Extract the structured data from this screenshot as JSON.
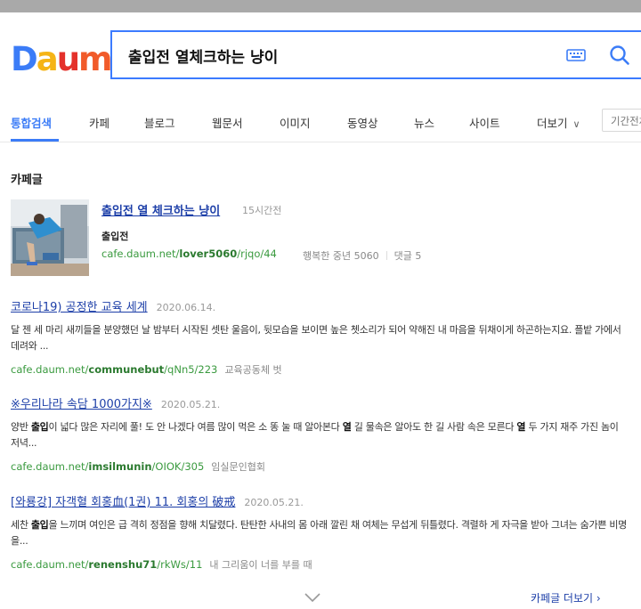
{
  "logo": {
    "letters": [
      "D",
      "a",
      "u",
      "m"
    ],
    "colors": [
      "#3b7cf7",
      "#f5b416",
      "#e4312b",
      "#f15b2a"
    ]
  },
  "search": {
    "query": "출입전 열체크하는 냥이",
    "keyboard_icon": "keyboard-icon",
    "search_icon": "magnifier-icon"
  },
  "tabs": [
    {
      "label": "통합검색",
      "active": true
    },
    {
      "label": "카페"
    },
    {
      "label": "블로그"
    },
    {
      "label": "웹문서"
    },
    {
      "label": "이미지"
    },
    {
      "label": "동영상"
    },
    {
      "label": "뉴스"
    },
    {
      "label": "사이트"
    },
    {
      "label": "더보기"
    }
  ],
  "period_label": "기간전체",
  "section": {
    "title": "카페글"
  },
  "featured": {
    "title": "출입전 열 체크하는 냥이",
    "time": "15시간전",
    "sub": "출입전",
    "url_prefix": "cafe.daum.net/",
    "url_bold": "lover5060",
    "url_suffix": "/rjqo/44",
    "cafe_name": "행복한 중년 5060",
    "comments": "댓글 5"
  },
  "results": [
    {
      "title": "코로나19) 공정한 교육 세계",
      "date": "2020.06.14.",
      "desc_parts": [
        "달 젠 세 마리 새끼들을 분양했던 날 밤부터 시작된 셋탄 울음이, 뒷모습을 보이면 높은 쳇소리가 되어 약해진 내 마음을 뒤채이게 하곤하는지요. 플밭 가에서 데려와 ..."
      ],
      "url_prefix": "cafe.daum.net/",
      "url_bold": "communebut",
      "url_suffix": "/qNn5/223",
      "cafe": "교육공동체 벗"
    },
    {
      "title": "※우리나라 속담 1000가지※",
      "date": "2020.05.21.",
      "desc_a": "양반 ",
      "desc_b": "출입",
      "desc_c": "이 넓다 많은 자리에 풀! 도 안 나겠다 여름 많이 먹은 소 똥 눌 때 알아본다 ",
      "desc_d": "열",
      "desc_e": " 길 물속은 알아도 한 길 사람 속은 모른다 ",
      "desc_f": "열",
      "desc_g": " 두 가지 재주 가진 놈이 저녁...",
      "url_prefix": "cafe.daum.net/",
      "url_bold": "imsilmunin",
      "url_suffix": "/OIOK/305",
      "cafe": "임실문인협회"
    },
    {
      "title": "[와룡강] 자객혈 회홍血(1권) 11. 회홍의 破戒",
      "date": "2020.05.21.",
      "desc_a": "세찬 ",
      "desc_b": "출입",
      "desc_c": "을 느끼며 여인은 급 격히 정점을 향해 치달렸다. 탄탄한 사내의 몸 아래 깔린 채 여체는 무섭게 뒤틀렸다. 격렬하 게 자극을 받아 그녀는 숨가쁜 비명을...",
      "url_prefix": "cafe.daum.net/",
      "url_bold": "renenshu71",
      "url_suffix": "/rkWs/11",
      "cafe": "내 그리움이 너를 부를 때"
    }
  ],
  "more": {
    "label": "카페글 더보기 ›",
    "chevron": "chevron-down-icon"
  }
}
